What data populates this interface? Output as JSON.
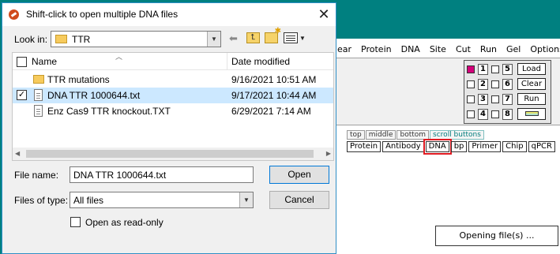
{
  "dialog": {
    "title": "Shift-click to open multiple DNA files",
    "close_glyph": "✕",
    "look_in_label": "Look in:",
    "look_in_value": "TTR",
    "columns": {
      "name": "Name",
      "date": "Date modified"
    },
    "files": [
      {
        "name": "TTR mutations",
        "date": "9/16/2021 10:51 AM",
        "kind": "folder",
        "selected": false
      },
      {
        "name": "DNA TTR 1000644.txt",
        "date": "9/17/2021 10:44 AM",
        "kind": "file",
        "selected": true
      },
      {
        "name": "Enz Cas9 TTR knockout.TXT",
        "date": "6/29/2021 7:14 AM",
        "kind": "file",
        "selected": false
      }
    ],
    "file_name_label": "File name:",
    "file_name_value": "DNA TTR 1000644.txt",
    "file_type_label": "Files of type:",
    "file_type_value": "All files",
    "readonly_label": "Open as read-only",
    "open_label": "Open",
    "cancel_label": "Cancel"
  },
  "app": {
    "menu": [
      "ear",
      "Protein",
      "DNA",
      "Site",
      "Cut",
      "Run",
      "Gel",
      "Options"
    ],
    "lanes": [
      "1",
      "2",
      "3",
      "4",
      "5",
      "6",
      "7",
      "8"
    ],
    "lane_checked_color": "#d4007a",
    "gel_buttons": [
      "Load",
      "Clear",
      "Run"
    ],
    "tabs": [
      "top",
      "middle",
      "bottom",
      "scroll buttons"
    ],
    "buttons": [
      "Protein",
      "Antibody",
      "DNA",
      "bp",
      "Primer",
      "Chip",
      "qPCR"
    ],
    "highlighted_button": "DNA",
    "highlight_color": "#e01b22",
    "status": "Opening file(s) ..."
  }
}
